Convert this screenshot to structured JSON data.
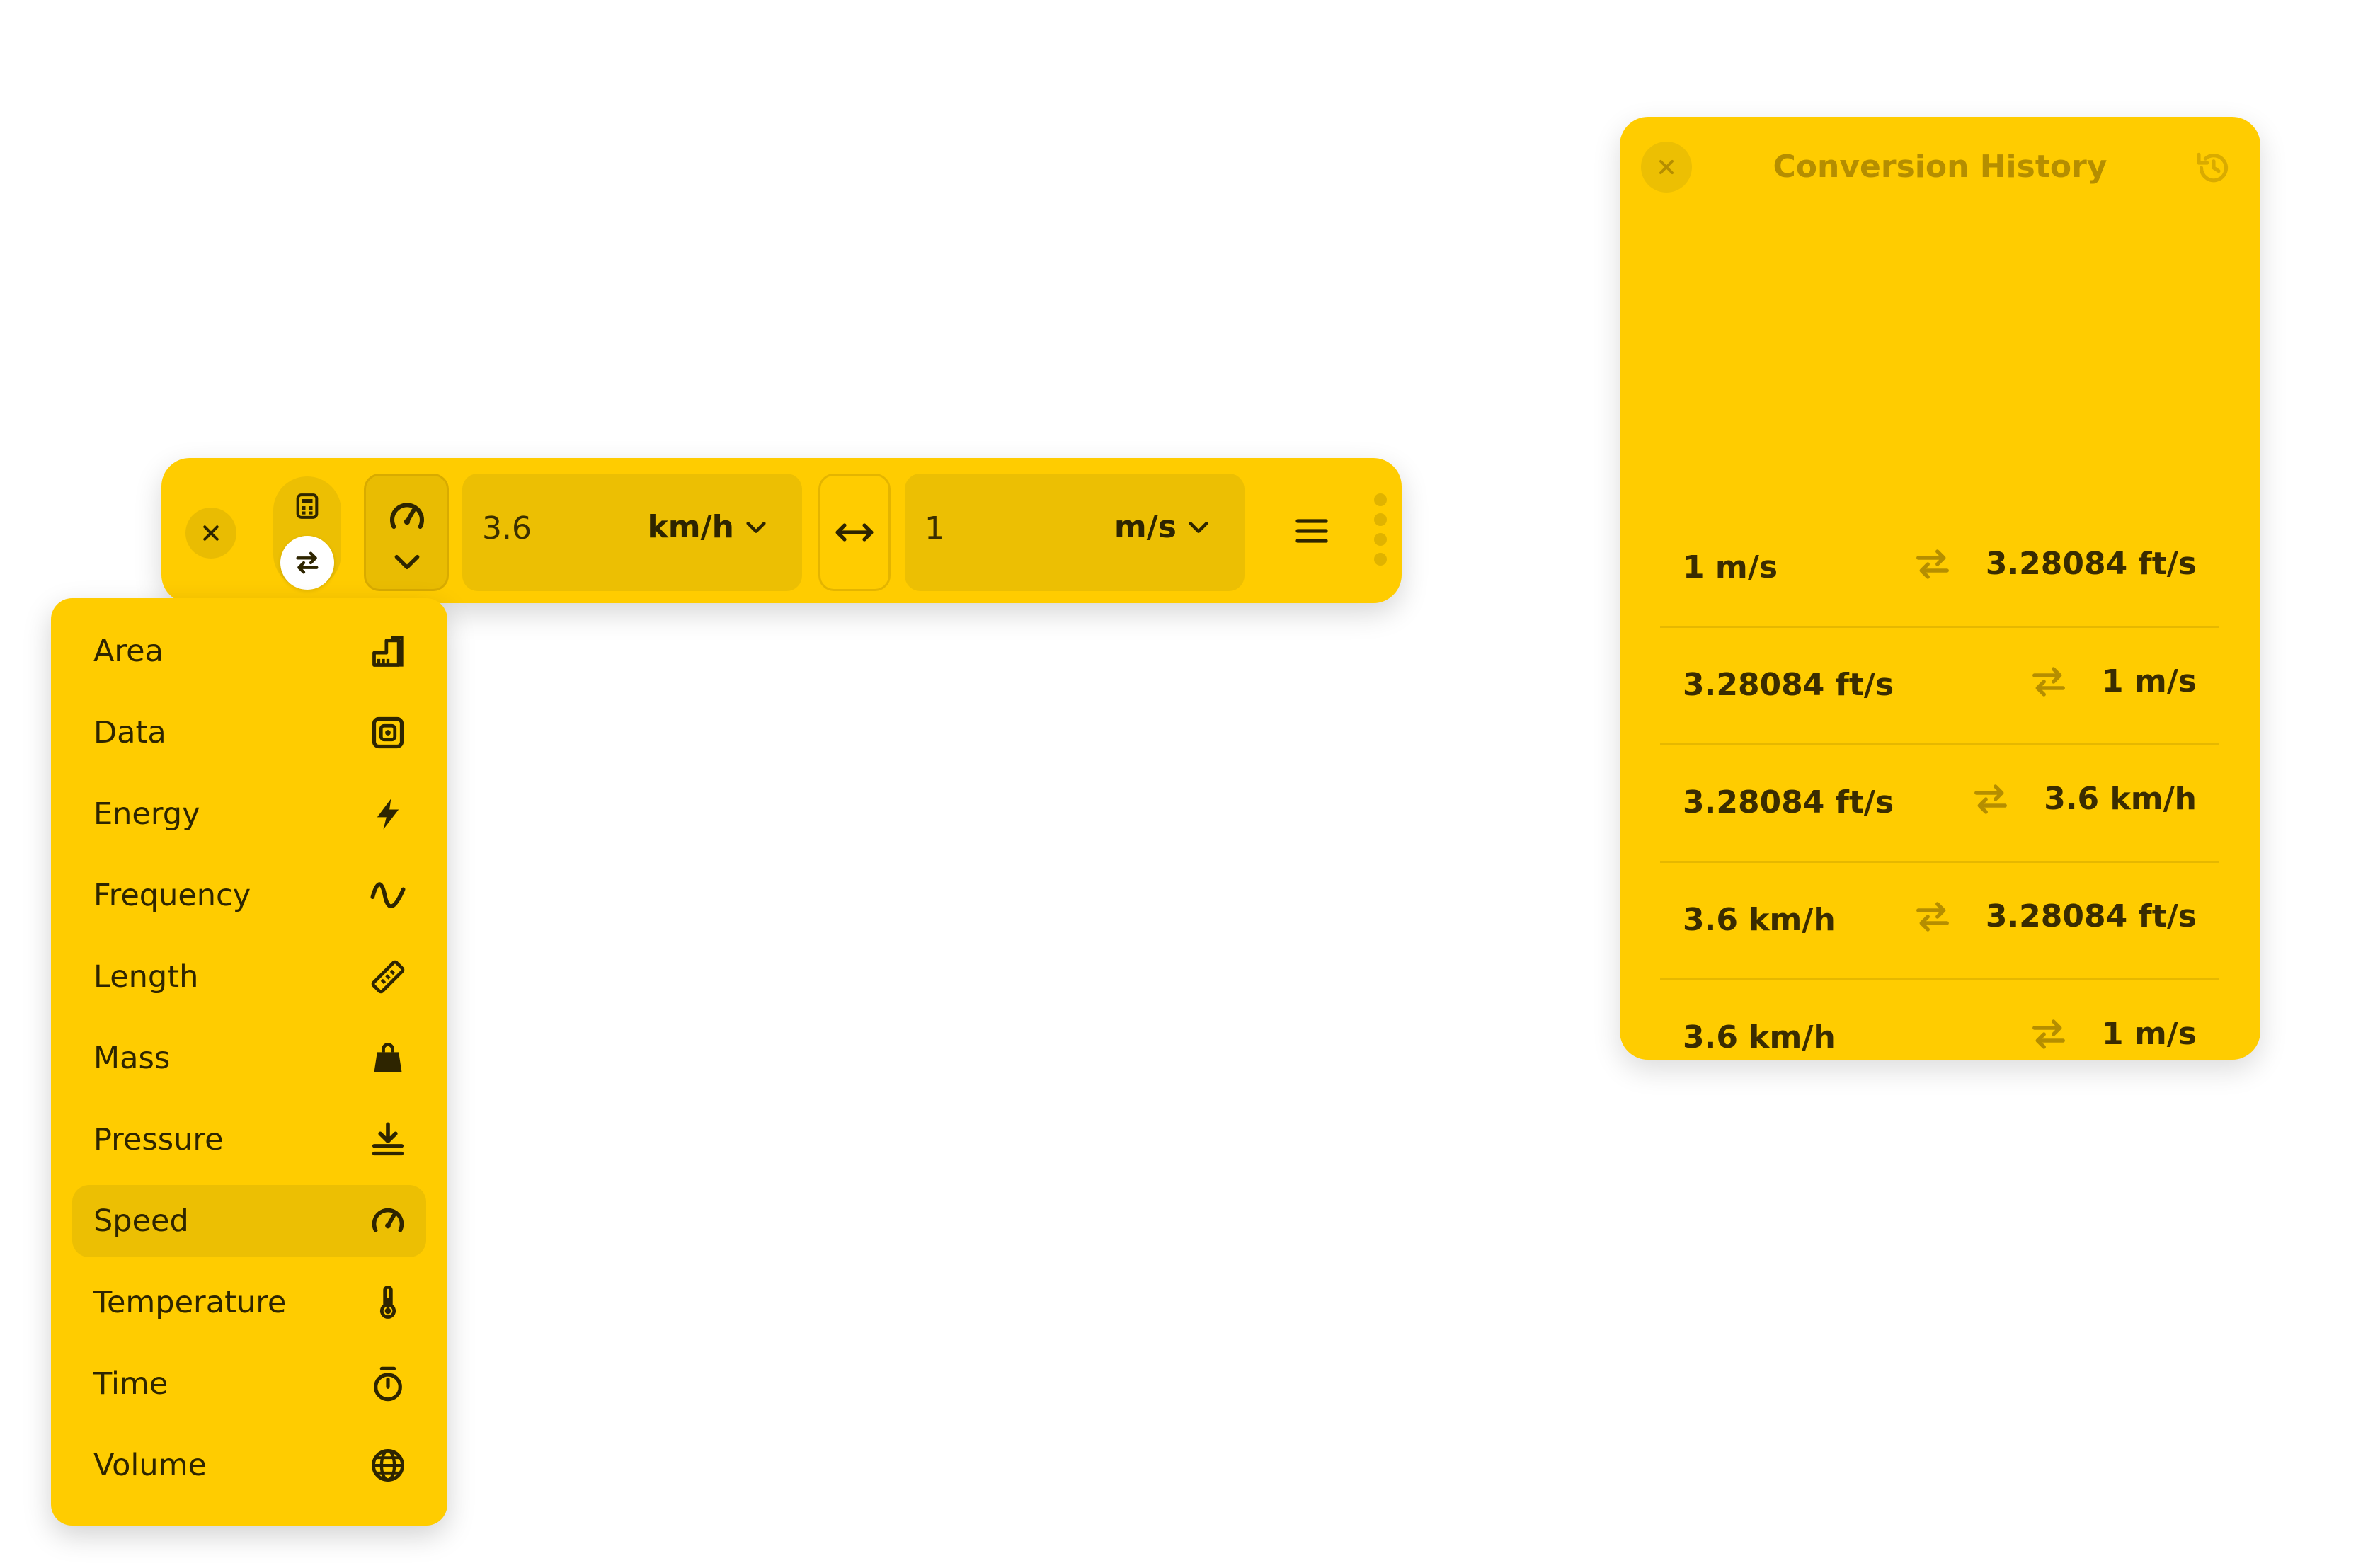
{
  "converter": {
    "from_value": "3.6",
    "from_unit": "km/h",
    "to_value": "1",
    "to_unit": "m/s"
  },
  "categories": [
    {
      "label": "Area",
      "icon": "area-icon"
    },
    {
      "label": "Data",
      "icon": "data-icon"
    },
    {
      "label": "Energy",
      "icon": "energy-icon"
    },
    {
      "label": "Frequency",
      "icon": "frequency-icon"
    },
    {
      "label": "Length",
      "icon": "ruler-icon"
    },
    {
      "label": "Mass",
      "icon": "weight-icon"
    },
    {
      "label": "Pressure",
      "icon": "pressure-icon"
    },
    {
      "label": "Speed",
      "icon": "gauge-icon",
      "selected": true
    },
    {
      "label": "Temperature",
      "icon": "thermometer-icon"
    },
    {
      "label": "Time",
      "icon": "stopwatch-icon"
    },
    {
      "label": "Volume",
      "icon": "globe-icon"
    }
  ],
  "history": {
    "title": "Conversion History",
    "entries": [
      {
        "from": "1 m/s",
        "to": "3.28084 ft/s"
      },
      {
        "from": "3.28084 ft/s",
        "to": "1 m/s"
      },
      {
        "from": "3.28084 ft/s",
        "to": "3.6 km/h"
      },
      {
        "from": "3.6 km/h",
        "to": "3.28084 ft/s"
      },
      {
        "from": "3.6 km/h",
        "to": "1 m/s"
      }
    ]
  },
  "colors": {
    "accent": "#ffcc00",
    "accent_dark": "#ecbf03",
    "text": "#2e2500",
    "muted": "#b58e00"
  }
}
